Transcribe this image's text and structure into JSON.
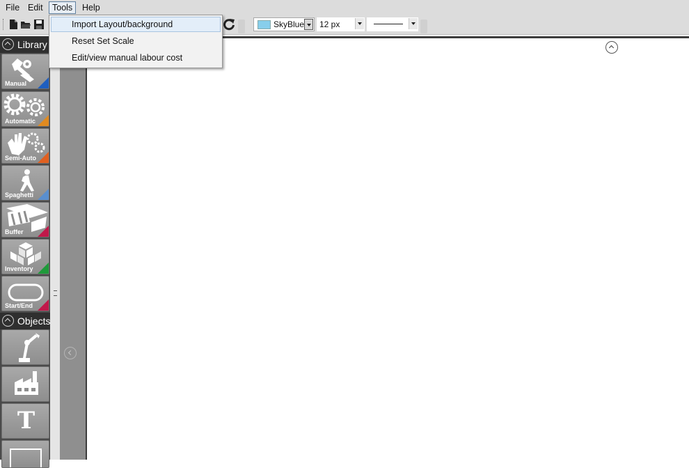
{
  "menubar": {
    "items": [
      {
        "label": "File"
      },
      {
        "label": "Edit"
      },
      {
        "label": "Tools"
      },
      {
        "label": "Help"
      }
    ]
  },
  "tools_menu": {
    "items": [
      {
        "label": "Import Layout/background",
        "highlighted": true
      },
      {
        "label": "Reset Set Scale"
      },
      {
        "label": "Edit/view manual labour cost"
      }
    ]
  },
  "toolbar": {
    "icons": [
      "new-file-icon",
      "open-folder-icon",
      "save-icon",
      "redo-icon"
    ],
    "color_select": {
      "value": "SkyBlue",
      "swatch": "#87ceeb"
    },
    "size_select": {
      "value": "12 px"
    },
    "line_style_select": {
      "value": "solid"
    }
  },
  "library": {
    "header": "Library",
    "tiles": [
      {
        "label": "Manual",
        "icon": "wrench-hand-icon",
        "corner": "#1f5fbf"
      },
      {
        "label": "Automatic",
        "icon": "gears-icon",
        "corner": "#e08a20"
      },
      {
        "label": "Semi-Auto",
        "icon": "hand-gears-icon",
        "corner": "#e06020"
      },
      {
        "label": "Spaghetti",
        "icon": "walking-person-icon",
        "corner": "#5a8fcf"
      },
      {
        "label": "Buffer",
        "icon": "pallet-icon",
        "corner": "#c0184a"
      },
      {
        "label": "Inventory",
        "icon": "boxes-icon",
        "corner": "#1f9a3a"
      },
      {
        "label": "Start/End",
        "icon": "rounded-rect-icon",
        "corner": "#c0184a"
      }
    ]
  },
  "objects": {
    "header": "Objects",
    "tiles": [
      {
        "icon": "robot-arm-icon"
      },
      {
        "icon": "factory-icon"
      },
      {
        "icon": "text-icon",
        "glyph": "T"
      },
      {
        "icon": "rectangle-icon"
      }
    ]
  }
}
